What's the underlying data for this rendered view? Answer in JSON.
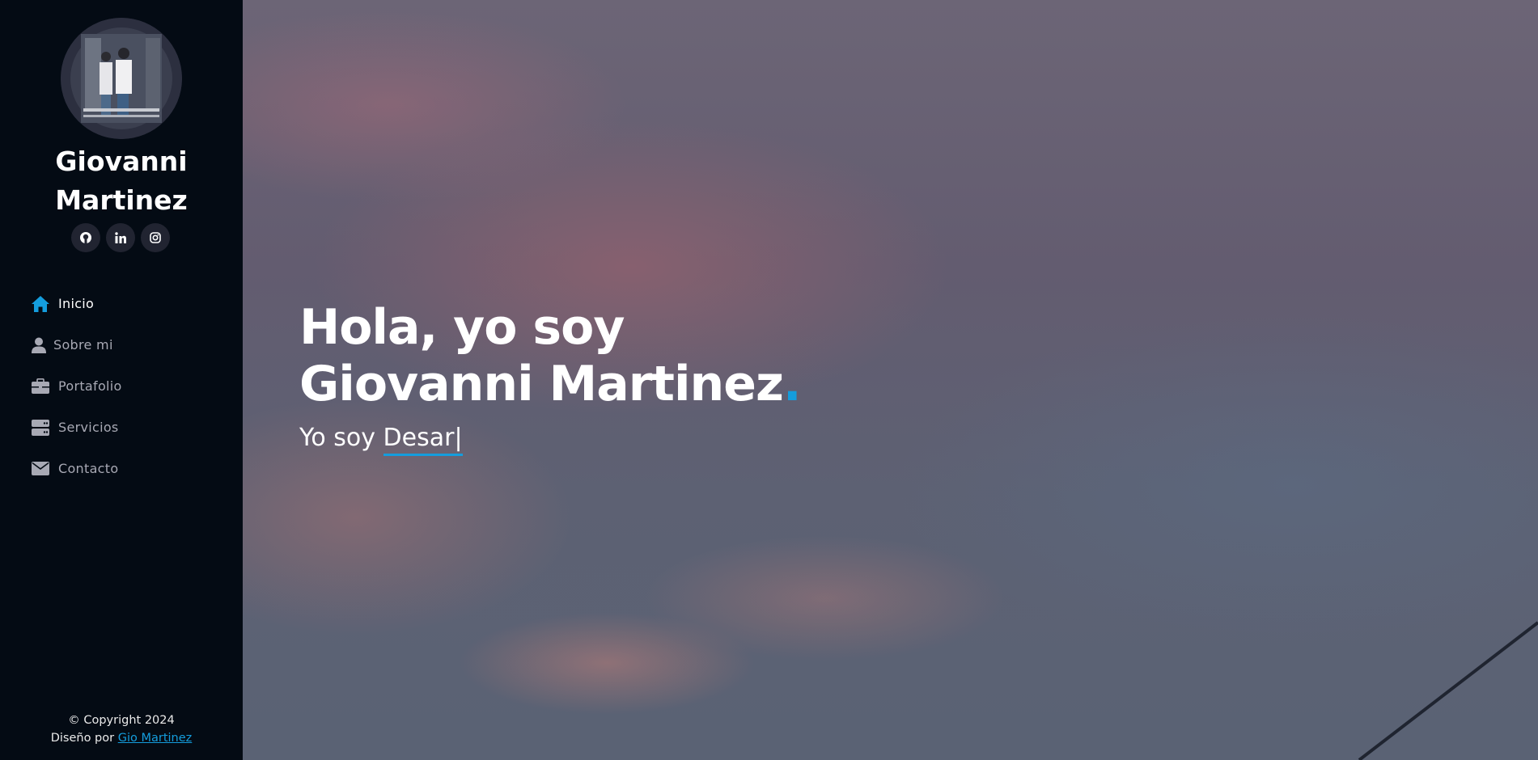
{
  "profile": {
    "name": "Giovanni Martinez"
  },
  "social": [
    {
      "icon": "github-icon"
    },
    {
      "icon": "linkedin-icon"
    },
    {
      "icon": "instagram-icon"
    }
  ],
  "nav": {
    "items": [
      {
        "label": "Inicio",
        "icon": "home-icon",
        "active": true
      },
      {
        "label": "Sobre mi",
        "icon": "user-icon"
      },
      {
        "label": "Portafolio",
        "icon": "briefcase-icon"
      },
      {
        "label": "Servicios",
        "icon": "server-icon"
      },
      {
        "label": "Contacto",
        "icon": "envelope-icon"
      }
    ]
  },
  "hero": {
    "title_line1": "Hola, yo soy",
    "title_line2": "Giovanni Martinez",
    "title_dot": ".",
    "subtitle_prefix": "Yo soy",
    "typed_text": "Desar",
    "cursor": "|"
  },
  "footer": {
    "copyright": "© Copyright 2024",
    "credit_prefix": "Diseño por",
    "credit_link": "Gio Martinez"
  },
  "colors": {
    "accent": "#149ddd",
    "sidebar_bg": "#040b14",
    "nav_text": "#a8a9b4"
  }
}
